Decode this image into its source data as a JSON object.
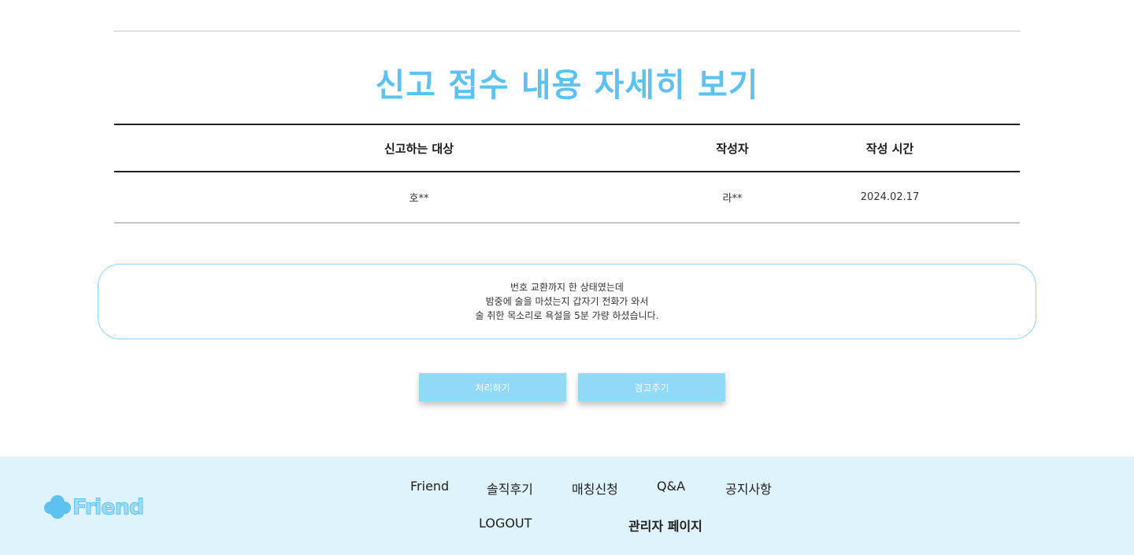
{
  "title": "신고 접수 내용 자세히 보기",
  "table": {
    "headers": {
      "target": "신고하는 대상",
      "author": "작성자",
      "time": "작성 시간"
    },
    "row": {
      "target": "호**",
      "author": "라**",
      "time": "2024.02.17"
    }
  },
  "content": {
    "lines": [
      "번호 교환까지 한 상태였는데",
      "밤중에 술을 마셨는지 갑자기 전화가 와서",
      "술 취한 목소리로 욕설을 5분 가량 하셨습니다."
    ]
  },
  "buttons": {
    "process": "처리하기",
    "warn": "경고주기"
  },
  "footer": {
    "logo_text": "Friend",
    "nav": {
      "friend": "Friend",
      "reviews": "솔직후기",
      "matching": "매칭신청",
      "qna": "Q&A",
      "notice": "공지사항",
      "logout": "LOGOUT",
      "admin": "관리자 페이지"
    }
  },
  "colors": {
    "accent": "#5ec1f0",
    "button": "#92d8f7",
    "footer_bg": "#def3fb",
    "box_border": "#8fd3f0"
  }
}
